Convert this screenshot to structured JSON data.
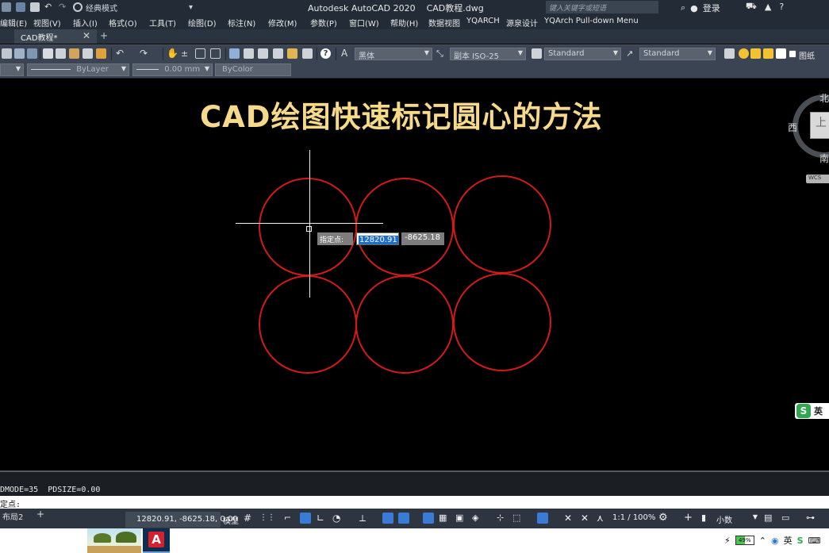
{
  "titlebar": {
    "workspace": "经典模式",
    "app_title": "Autodesk AutoCAD 2020    CAD教程.dwg",
    "search_placeholder": "键入关键字或短语",
    "login": "登录"
  },
  "menu": [
    "编辑(E)",
    "视图(V)",
    "插入(I)",
    "格式(O)",
    "工具(T)",
    "绘图(D)",
    "标注(N)",
    "修改(M)",
    "参数(P)",
    "窗口(W)",
    "帮助(H)",
    "数据视图",
    "YQARCH",
    "源泉设计",
    "YQArch Pull-down Menu"
  ],
  "tabs": {
    "document": "CAD教程*",
    "new_tab": "+"
  },
  "toolbar": {
    "text_font": "黑体",
    "dim_style": "副本 ISO-25",
    "table_style": "Standard",
    "mleader_style": "Standard",
    "paper_label": "图纸",
    "linetype": "ByLayer",
    "lineweight": "0.00 mm",
    "plotstyle": "ByColor"
  },
  "canvas": {
    "video_title": "CAD绘图快速标记圆心的方法",
    "circle_color": "#d11a1a",
    "background": "#000000",
    "circles": [
      {
        "row": 1,
        "col": 1
      },
      {
        "row": 1,
        "col": 2
      },
      {
        "row": 1,
        "col": 3
      },
      {
        "row": 2,
        "col": 1
      },
      {
        "row": 2,
        "col": 2
      },
      {
        "row": 2,
        "col": 3
      }
    ]
  },
  "dynamic_input": {
    "prompt": "指定点:",
    "x_value": "12820.91",
    "y_value": "-8625.18"
  },
  "viewcube": {
    "north": "北",
    "west": "西",
    "south": "南",
    "face": "上",
    "wcs": "WCS"
  },
  "ime": {
    "logo": "S",
    "mode": "英"
  },
  "command": {
    "history": "DMODE=35  PDSIZE=0.00",
    "current": "定点:"
  },
  "statusbar": {
    "layout_tab": "布局2",
    "add_tab": "+",
    "coordinates": "12820.91, -8625.18, 0.00",
    "model": "模型",
    "scale": "1:1 / 100%",
    "units": "小数"
  },
  "taskbar": {
    "acad_icon": "A",
    "battery": "49%",
    "ime": "英"
  }
}
